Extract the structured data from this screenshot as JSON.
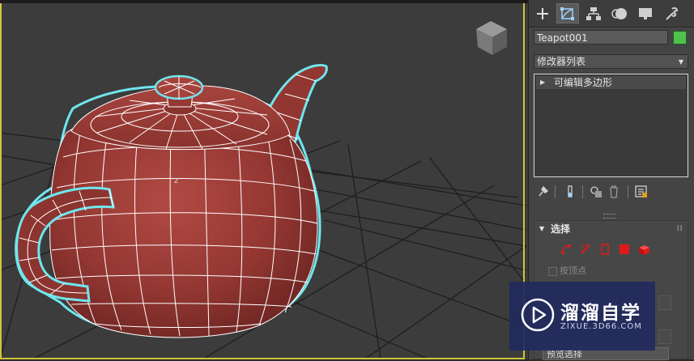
{
  "command_panel": {
    "tabs": [
      {
        "name": "create",
        "icon": "plus-icon"
      },
      {
        "name": "modify",
        "icon": "modify-icon"
      },
      {
        "name": "hierarchy",
        "icon": "hierarchy-icon"
      },
      {
        "name": "motion",
        "icon": "motion-icon"
      },
      {
        "name": "display",
        "icon": "display-icon"
      },
      {
        "name": "utilities",
        "icon": "wrench-icon"
      }
    ],
    "object_name": "Teapot001",
    "object_color": "#4ec24c",
    "modifier_list_label": "修改器列表",
    "stack_items": [
      {
        "label": "可编辑多边形"
      }
    ],
    "selection_rollout": {
      "title": "选择",
      "by_vertex_label": "按顶点",
      "preview_label": "预览选择"
    }
  },
  "colors": {
    "viewport_bg": "#3c3c3c",
    "mesh_fill": "#9a3b35",
    "wire": "#ffffff",
    "selection_outline": "#6fe6ee",
    "subobject_red": "#e01a1a"
  },
  "watermark": {
    "brand": "溜溜自学",
    "url": "ZIXUE.3D66.COM"
  }
}
